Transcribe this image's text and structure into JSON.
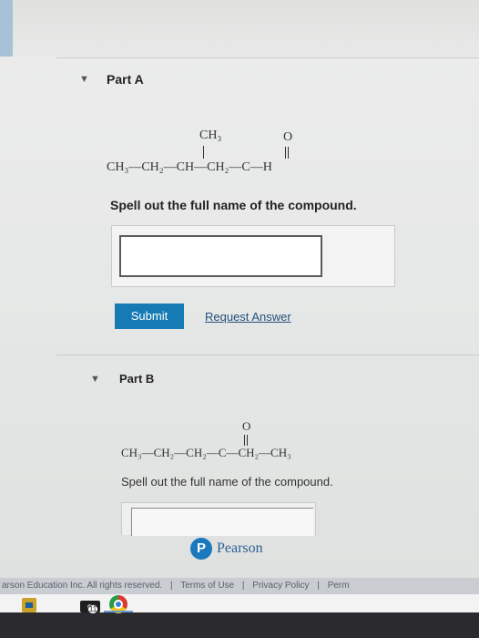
{
  "part_a": {
    "toggle": "▼",
    "title": "Part A",
    "formula": {
      "chain": "CH₃—CH₂—CH—CH₂—C—H",
      "branch": "CH₃",
      "carbonyl": "O"
    },
    "instruction": "Spell out the full name of the compound.",
    "answer_value": "",
    "submit_label": "Submit",
    "request_label": "Request Answer"
  },
  "part_b": {
    "toggle": "▼",
    "title": "Part B",
    "formula": {
      "chain": "CH₃—CH₂—CH₂—C—CH₂—CH₃",
      "carbonyl": "O"
    },
    "instruction": "Spell out the full name of the compound."
  },
  "brand": {
    "logo_letter": "P",
    "name": "Pearson"
  },
  "footer": {
    "copyright": "arson Education Inc. All rights reserved.",
    "sep1": "|",
    "terms": "Terms of Use",
    "sep2": "|",
    "privacy": "Privacy Policy",
    "sep3": "|",
    "perm": "Perm"
  },
  "taskbar": {
    "camera_badge": "11"
  },
  "colors": {
    "submit_bg": "#167bb4",
    "link": "#24507c",
    "brand": "#1b78bd"
  }
}
